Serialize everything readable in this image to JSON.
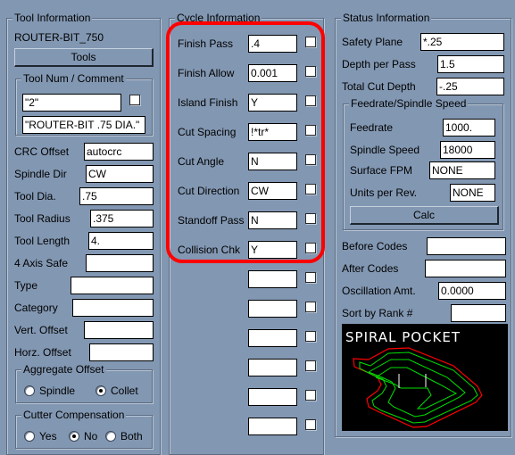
{
  "tool_info": {
    "title": "Tool Information",
    "tool_name": "ROUTER-BIT_750",
    "tools_button": "Tools",
    "tool_num_group": {
      "title": "Tool Num / Comment",
      "tool_num": "\"2\"",
      "tool_num_checked": false,
      "comment": "\"ROUTER-BIT .75 DIA.\""
    },
    "fields": [
      {
        "label": "CRC Offset",
        "value": "autocrc"
      },
      {
        "label": "Spindle Dir",
        "value": "CW"
      },
      {
        "label": "Tool Dia.",
        "value": ".75"
      },
      {
        "label": "Tool Radius",
        "value": ".375"
      },
      {
        "label": "Tool Length",
        "value": "4."
      },
      {
        "label": "4 Axis Safe",
        "value": ""
      },
      {
        "label": "Type",
        "value": ""
      },
      {
        "label": "Category",
        "value": ""
      },
      {
        "label": "Vert. Offset",
        "value": ""
      },
      {
        "label": "Horz. Offset",
        "value": ""
      }
    ],
    "aggregate_offset": {
      "title": "Aggregate Offset",
      "options": [
        "Spindle",
        "Collet"
      ],
      "selected": "Collet"
    },
    "cutter_compensation": {
      "title": "Cutter Compensation",
      "options": [
        "Yes",
        "No",
        "Both"
      ],
      "selected": "No"
    }
  },
  "cycle_info": {
    "title": "Cycle Information",
    "rows": [
      {
        "label": "Finish Pass",
        "value": ".4",
        "checked": false
      },
      {
        "label": "Finish Allow",
        "value": "0.001",
        "checked": false
      },
      {
        "label": "Island Finish",
        "value": "Y",
        "checked": false
      },
      {
        "label": "Cut Spacing",
        "value": "!*tr*",
        "checked": false
      },
      {
        "label": "Cut Angle",
        "value": "N",
        "checked": false
      },
      {
        "label": "Cut Direction",
        "value": "CW",
        "checked": false
      },
      {
        "label": "Standoff Pass",
        "value": "N",
        "checked": false
      },
      {
        "label": "Collision Chk",
        "value": "Y",
        "checked": false
      },
      {
        "label": "",
        "value": "",
        "checked": false
      },
      {
        "label": "",
        "value": "",
        "checked": false
      },
      {
        "label": "",
        "value": "",
        "checked": false
      },
      {
        "label": "",
        "value": "",
        "checked": false
      },
      {
        "label": "",
        "value": "",
        "checked": false
      },
      {
        "label": "",
        "value": "",
        "checked": false
      }
    ],
    "highlight_color": "#ff0000"
  },
  "status_info": {
    "title": "Status Information",
    "fields": [
      {
        "label": "Safety Plane",
        "value": "*.25"
      },
      {
        "label": "Depth per Pass",
        "value": "1.5"
      },
      {
        "label": "Total Cut Depth",
        "value": "-.25"
      }
    ],
    "feed_group": {
      "title": "Feedrate/Spindle Speed",
      "fields": [
        {
          "label": "Feedrate",
          "value": "1000."
        },
        {
          "label": "Spindle Speed",
          "value": "18000"
        },
        {
          "label": "Surface FPM",
          "value": "NONE"
        },
        {
          "label": "Units per Rev.",
          "value": "NONE"
        }
      ],
      "calc_button": "Calc"
    },
    "fields2": [
      {
        "label": "Before Codes",
        "value": ""
      },
      {
        "label": "After Codes",
        "value": ""
      },
      {
        "label": "Oscillation Amt.",
        "value": "0.0000"
      },
      {
        "label": "Sort by Rank #",
        "value": ""
      }
    ],
    "preview": {
      "title": "SPIRAL POCKET",
      "outline_color": "#ff0000",
      "path_color": "#00e000",
      "lead_color": "#ffffff"
    }
  }
}
